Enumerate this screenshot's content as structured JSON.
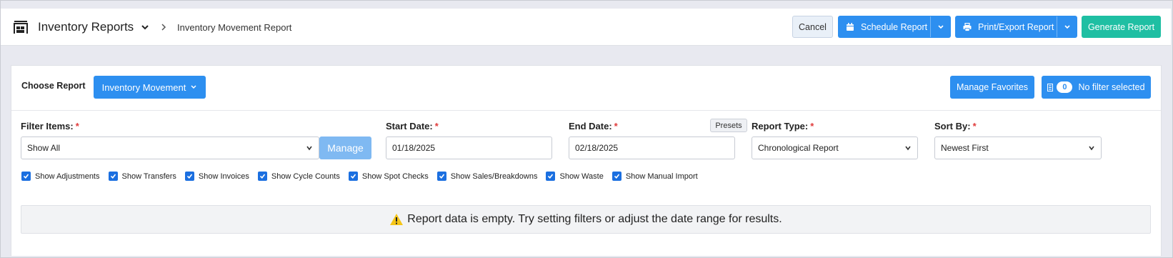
{
  "header": {
    "app_title": "Inventory Reports",
    "breadcrumb": "Inventory Movement Report",
    "icons": {
      "app": "warehouse-icon",
      "title_dropdown": "chevron-down-icon",
      "separator": "chevron-right-icon"
    },
    "buttons": {
      "cancel": "Cancel",
      "schedule": "Schedule Report",
      "print": "Print/Export Report",
      "generate": "Generate Report"
    },
    "colors": {
      "primary": "#2d8ff0",
      "success": "#1fbfa3"
    }
  },
  "report": {
    "choose_label": "Choose Report",
    "selected": "Inventory Movement",
    "manage_favorites": "Manage Favorites",
    "filter_count": "0",
    "filter_status": "No filter selected"
  },
  "filters": {
    "filter_items": {
      "label": "Filter Items:",
      "value": "Show All",
      "manage": "Manage"
    },
    "start_date": {
      "label": "Start Date:",
      "value": "01/18/2025"
    },
    "end_date": {
      "label": "End Date:",
      "value": "02/18/2025",
      "presets": "Presets"
    },
    "report_type": {
      "label": "Report Type:",
      "value": "Chronological Report"
    },
    "sort_by": {
      "label": "Sort By:",
      "value": "Newest First"
    },
    "required_marker": "*"
  },
  "checkboxes": [
    {
      "label": "Show Adjustments",
      "checked": true
    },
    {
      "label": "Show Transfers",
      "checked": true
    },
    {
      "label": "Show Invoices",
      "checked": true
    },
    {
      "label": "Show Cycle Counts",
      "checked": true
    },
    {
      "label": "Show Spot Checks",
      "checked": true
    },
    {
      "label": "Show Sales/Breakdowns",
      "checked": true
    },
    {
      "label": "Show Waste",
      "checked": true
    },
    {
      "label": "Show Manual Import",
      "checked": true
    }
  ],
  "message": "Report data is empty. Try setting filters or adjust the date range for results."
}
